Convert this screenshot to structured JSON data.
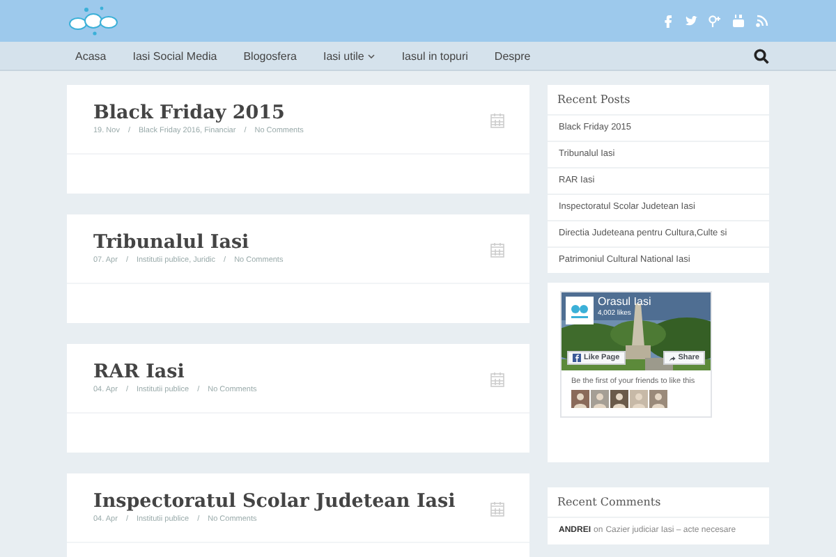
{
  "nav": {
    "items": [
      {
        "label": "Acasa",
        "dropdown": false
      },
      {
        "label": "Iasi Social Media",
        "dropdown": false
      },
      {
        "label": "Blogosfera",
        "dropdown": false
      },
      {
        "label": "Iasi utile",
        "dropdown": true
      },
      {
        "label": "Iasul in topuri",
        "dropdown": false
      },
      {
        "label": "Despre",
        "dropdown": false
      }
    ]
  },
  "posts": [
    {
      "title": "Black Friday 2015",
      "meta": [
        "19. Nov",
        "/",
        "Black Friday 2016, Financiar",
        "/",
        "No Comments"
      ]
    },
    {
      "title": "Tribunalul Iasi",
      "meta": [
        "07. Apr",
        "/",
        "Institutii publice, Juridic",
        "/",
        "No Comments"
      ]
    },
    {
      "title": "RAR Iasi",
      "meta": [
        "04. Apr",
        "/",
        "Institutii publice",
        "/",
        "No Comments"
      ]
    },
    {
      "title": "Inspectoratul Scolar Judetean Iasi",
      "meta": [
        "04. Apr",
        "/",
        "Institutii publice",
        "/",
        "No Comments"
      ]
    }
  ],
  "recent_posts": {
    "title": "Recent Posts",
    "items": [
      "Black Friday 2015",
      "Tribunalul Iasi",
      "RAR Iasi",
      "Inspectoratul Scolar Judetean Iasi",
      "Directia Judeteana pentru Cultura,Culte si",
      "Patrimoniul Cultural National Iasi"
    ]
  },
  "facebook": {
    "page_name": "Orasul Iasi",
    "likes": "4,002 likes",
    "like_button": "Like Page",
    "share_button": "Share",
    "friends_text": "Be the first of your friends to like this"
  },
  "recent_comments": {
    "title": "Recent Comments",
    "items": [
      {
        "author": "ANDREI",
        "connector": "on",
        "post": "Cazier judiciar Iasi – acte necesare"
      }
    ]
  }
}
